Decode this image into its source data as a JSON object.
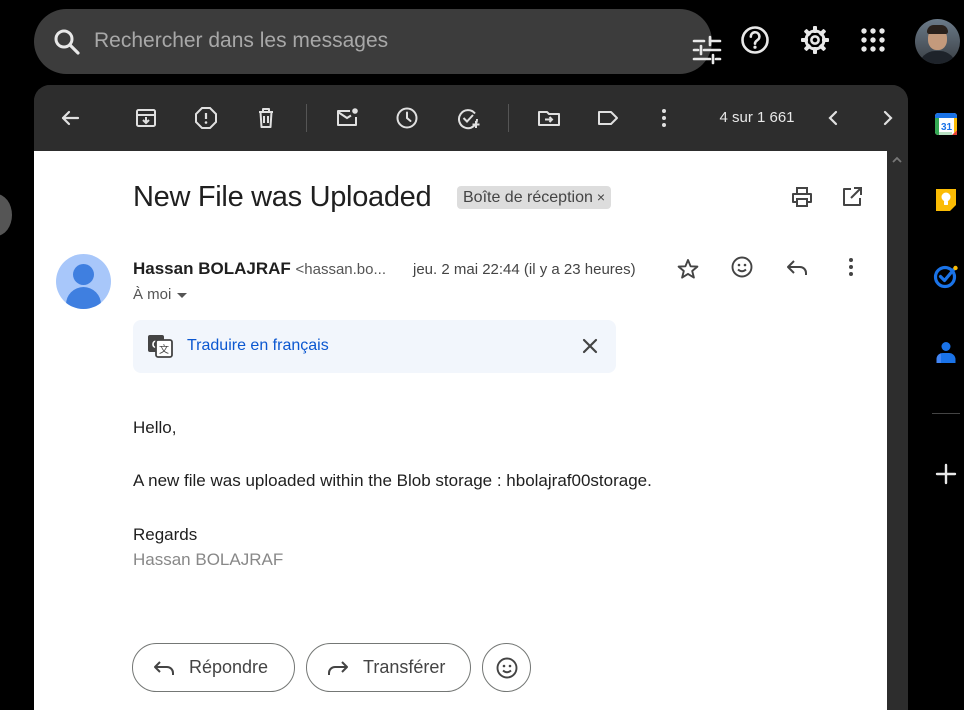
{
  "search": {
    "placeholder": "Rechercher dans les messages"
  },
  "toolbar": {
    "pager": "4 sur 1 661"
  },
  "email": {
    "subject": "New File was Uploaded",
    "label": "Boîte de réception",
    "label_close": "×",
    "sender_name": "Hassan BOLAJRAF",
    "sender_email": "<hassan.bo...",
    "date": "jeu. 2 mai 22:44 (il y a 23 heures)",
    "recipient": "À moi",
    "translate": "Traduire en français",
    "greeting": "Hello,",
    "message": "A new file was uploaded within the Blob storage : hbolajraf00storage.",
    "closing": "Regards",
    "signature": "Hassan BOLAJRAF"
  },
  "actions": {
    "reply": "Répondre",
    "forward": "Transférer"
  },
  "sidebar": {
    "calendar_day": "31"
  },
  "colors": {
    "accent": "#0b57d0",
    "background": "#000000",
    "panel": "#2d2d2d",
    "search": "#3c3c3c"
  }
}
